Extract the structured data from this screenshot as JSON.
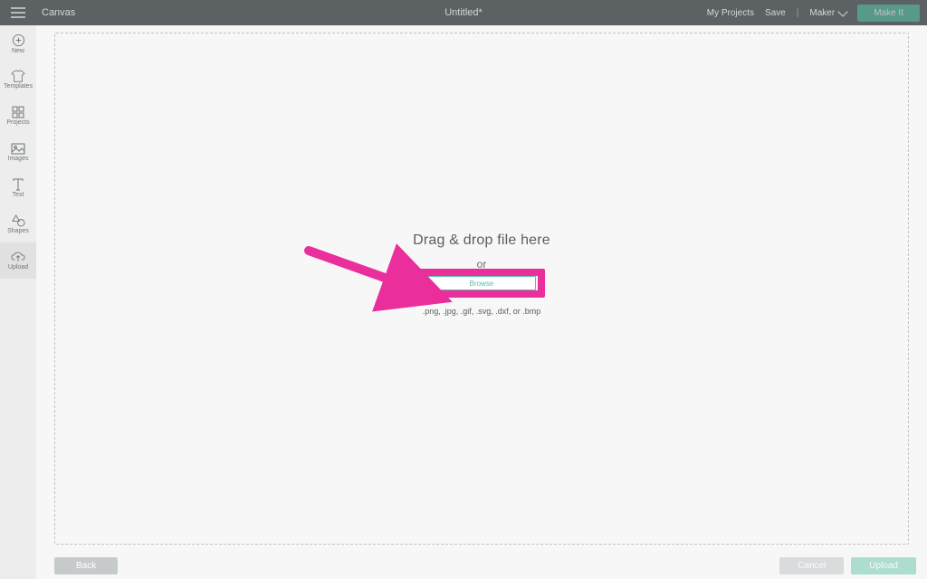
{
  "header": {
    "app_title": "Canvas",
    "doc_title": "Untitled*",
    "my_projects": "My Projects",
    "save": "Save",
    "separator": "|",
    "machine": "Maker",
    "make_label": "Make It"
  },
  "sidebar": {
    "items": [
      {
        "label": "New"
      },
      {
        "label": "Templates"
      },
      {
        "label": "Projects"
      },
      {
        "label": "Images"
      },
      {
        "label": "Text"
      },
      {
        "label": "Shapes"
      },
      {
        "label": "Upload"
      }
    ]
  },
  "dropzone": {
    "heading": "Drag & drop file here",
    "or": "or",
    "browse": "Browse",
    "formats": ".png, .jpg, .gif, .svg, .dxf, or .bmp"
  },
  "footer": {
    "back": "Back",
    "cancel": "Cancel",
    "upload": "Upload"
  },
  "annotation": {
    "arrow_color": "#ea2e9b"
  }
}
